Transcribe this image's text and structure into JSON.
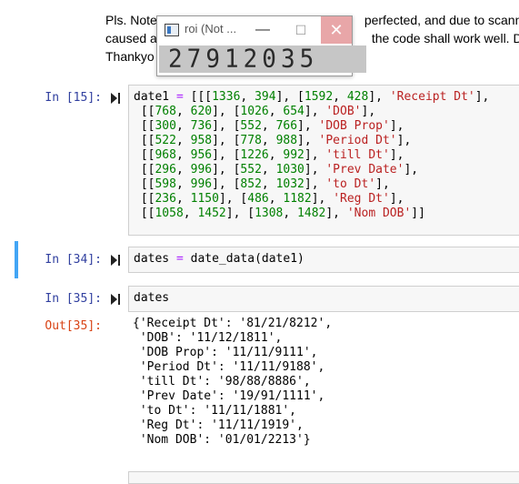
{
  "note": {
    "line1": "Pls. Note",
    "line1_tail": "perfected, and due to scann",
    "line2": "caused a",
    "line2_tail": "the code shall work well. Du",
    "line3": "Thankyo"
  },
  "popup": {
    "title": "roi (Not ...",
    "min_glyph": "—",
    "max_glyph": "☐",
    "close_glyph": "✕",
    "roi_digits": [
      "2",
      "7",
      "9",
      "1",
      "2",
      "0",
      "3",
      "5"
    ]
  },
  "cells": {
    "c15": {
      "prompt": "In [15]:",
      "lines": [
        "date1 = [[[1336, 394], [1592, 428], 'Receipt Dt'],",
        " [[768, 620], [1026, 654], 'DOB'],",
        " [[300, 736], [552, 766], 'DOB Prop'],",
        " [[522, 958], [778, 988], 'Period Dt'],",
        " [[968, 956], [1226, 992], 'till Dt'],",
        " [[296, 996], [552, 1030], 'Prev Date'],",
        " [[598, 996], [852, 1032], 'to Dt'],",
        " [[236, 1150], [486, 1182], 'Reg Dt'],",
        " [[1058, 1452], [1308, 1482], 'Nom DOB']]"
      ]
    },
    "c34": {
      "prompt": "In [34]:",
      "lines": [
        "dates = date_data(date1)"
      ]
    },
    "c35": {
      "prompt": "In [35]:",
      "lines": [
        "dates"
      ],
      "out_prompt": "Out[35]:",
      "output": [
        "{'Receipt Dt': '81/21/8212',",
        " 'DOB': '11/12/1811',",
        " 'DOB Prop': '11/11/9111',",
        " 'Period Dt': '11/11/9188',",
        " 'till Dt': '98/88/8886',",
        " 'Prev Date': '19/91/1111',",
        " 'to Dt': '11/11/1881',",
        " 'Reg Dt': '11/11/1919',",
        " 'Nom DOB': '01/01/2213'}"
      ]
    }
  },
  "colors": {
    "in_prompt": "#303f9f",
    "out_prompt": "#d84315",
    "string": "#ba2121",
    "number": "#008000",
    "operator": "#aa22ff",
    "selected_cell_bar": "#42a5f5"
  }
}
